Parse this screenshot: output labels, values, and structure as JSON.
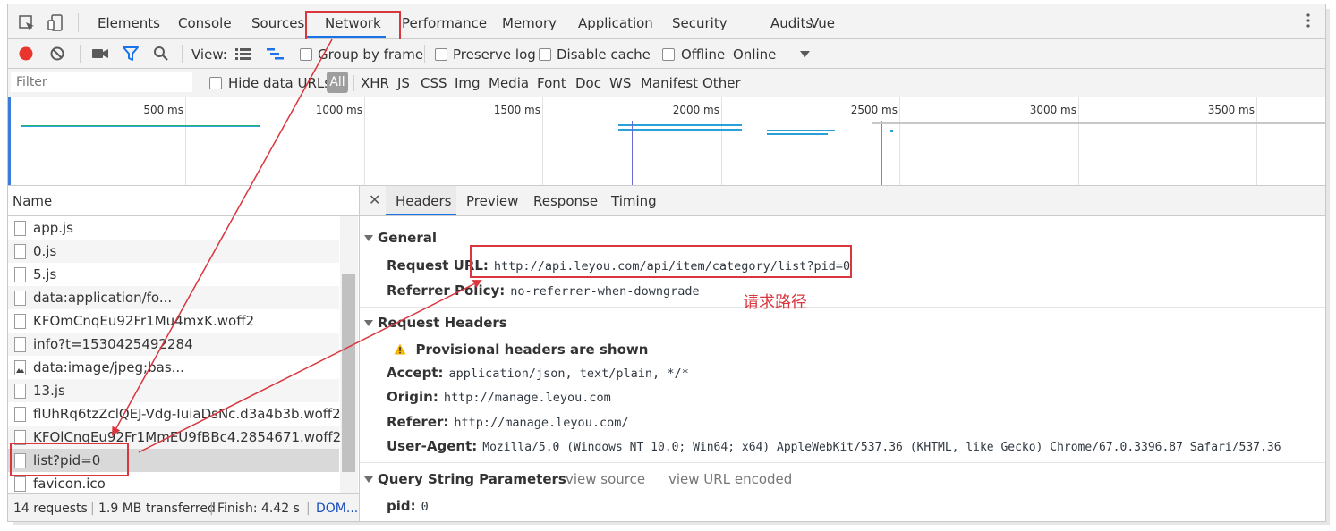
{
  "devtools": {
    "tabs": [
      "Elements",
      "Console",
      "Sources",
      "Network",
      "Performance",
      "Memory",
      "Application",
      "Security",
      "Audits",
      "Vue"
    ],
    "active_tab": "Network"
  },
  "toolbar": {
    "view_label": "View:",
    "group_by_frame": "Group by frame",
    "preserve_log": "Preserve log",
    "disable_cache": "Disable cache",
    "offline": "Offline",
    "throttle": "Online"
  },
  "filterbar": {
    "placeholder": "Filter",
    "hide_data_urls": "Hide data URLs",
    "types": [
      "All",
      "XHR",
      "JS",
      "CSS",
      "Img",
      "Media",
      "Font",
      "Doc",
      "WS",
      "Manifest",
      "Other"
    ],
    "active_type": "All"
  },
  "timeline": {
    "ticks": [
      "500 ms",
      "1000 ms",
      "1500 ms",
      "2000 ms",
      "2500 ms",
      "3000 ms",
      "3500 ms"
    ]
  },
  "requests": {
    "header": "Name",
    "items": [
      {
        "name": "app.js",
        "icon": "file-icon"
      },
      {
        "name": "0.js",
        "icon": "file-icon"
      },
      {
        "name": "5.js",
        "icon": "file-icon"
      },
      {
        "name": "data:application/fo...",
        "icon": "file-icon"
      },
      {
        "name": "KFOmCnqEu92Fr1Mu4mxK.woff2",
        "icon": "file-icon"
      },
      {
        "name": "info?t=1530425492284",
        "icon": "file-icon"
      },
      {
        "name": "data:image/jpeg;bas...",
        "icon": "image-file-icon"
      },
      {
        "name": "13.js",
        "icon": "file-icon"
      },
      {
        "name": "flUhRq6tzZclQEJ-Vdg-IuiaDsNc.d3a4b3b.woff2",
        "icon": "file-icon"
      },
      {
        "name": "KFOlCnqEu92Fr1MmEU9fBBc4.2854671.woff2",
        "icon": "file-icon"
      },
      {
        "name": "list?pid=0",
        "icon": "file-icon"
      },
      {
        "name": "favicon.ico",
        "icon": "file-icon"
      }
    ],
    "selected": "list?pid=0"
  },
  "status": {
    "requests": "14 requests",
    "transferred": "1.9 MB transferred",
    "finish": "Finish: 4.42 s",
    "dom": "DOM..."
  },
  "detail": {
    "tabs": [
      "Headers",
      "Preview",
      "Response",
      "Timing"
    ],
    "active_tab": "Headers",
    "general": {
      "title": "General",
      "request_url_key": "Request URL:",
      "request_url": "http://api.leyou.com/api/item/category/list?pid=0",
      "referrer_policy_key": "Referrer Policy:",
      "referrer_policy": "no-referrer-when-downgrade"
    },
    "request_headers": {
      "title": "Request Headers",
      "warning": "Provisional headers are shown",
      "accept_key": "Accept:",
      "accept": "application/json, text/plain, */*",
      "origin_key": "Origin:",
      "origin": "http://manage.leyou.com",
      "referer_key": "Referer:",
      "referer": "http://manage.leyou.com/",
      "user_agent_key": "User-Agent:",
      "user_agent": "Mozilla/5.0 (Windows NT 10.0; Win64; x64) AppleWebKit/537.36 (KHTML, like Gecko) Chrome/67.0.3396.87 Safari/537.36"
    },
    "query": {
      "title": "Query String Parameters",
      "view_source": "view source",
      "view_url_encoded": "view URL encoded",
      "pid_key": "pid:",
      "pid": "0"
    }
  },
  "annotation": "请求路径",
  "colors": {
    "accent": "#1a73e8",
    "annotation_red": "#d9363e",
    "record_red": "#e8352e",
    "filter_blue": "#1a73e8"
  }
}
